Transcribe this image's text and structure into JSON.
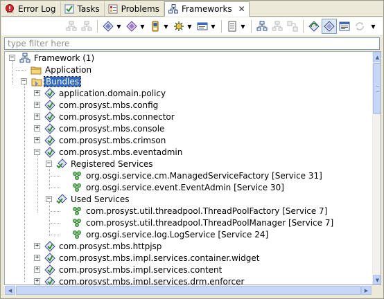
{
  "tabs": [
    {
      "label": "Error Log",
      "icon": "error-log-icon",
      "active": false
    },
    {
      "label": "Tasks",
      "icon": "tasks-icon",
      "active": false
    },
    {
      "label": "Problems",
      "icon": "problems-icon",
      "active": false
    },
    {
      "label": "Frameworks",
      "icon": "frameworks-icon",
      "active": true,
      "close": "✕"
    }
  ],
  "toolbar": {
    "buttons": [
      "connect-framework-icon",
      "disconnect-framework-icon",
      "install-bundle-icon",
      "start-bundle-icon",
      "mobile-device-icon",
      "remote-application-icon",
      "view-menu-icon",
      "properties-icon",
      "show-bundles-icon",
      "show-packages-icon",
      "show-services-icon",
      "refresh-services-icon",
      "show-bundle-ids-icon",
      "console-icon",
      "sync-icon"
    ],
    "dropdown_glyph": "▼"
  },
  "filter": {
    "placeholder": "type filter here",
    "value": ""
  },
  "tree": {
    "framework": "Framework (1)",
    "application": "Application",
    "bundles": "Bundles",
    "bundle_items": [
      "application.domain.policy",
      "com.prosyst.mbs.config",
      "com.prosyst.mbs.connector",
      "com.prosyst.mbs.console",
      "com.prosyst.mbs.crimson",
      "com.prosyst.mbs.eventadmin"
    ],
    "registered_services": "Registered Services",
    "registered_items": [
      "org.osgi.service.cm.ManagedServiceFactory [Service 31]",
      "org.osgi.service.event.EventAdmin [Service 30]"
    ],
    "used_services": "Used Services",
    "used_items": [
      "com.prosyst.util.threadpool.ThreadPoolFactory [Service 7]",
      "com.prosyst.util.threadpool.ThreadPoolManager [Service 7]",
      "org.osgi.service.log.LogService [Service 24]"
    ],
    "more_bundles": [
      "com.prosyst.mbs.httpjsp",
      "com.prosyst.mbs.impl.services.container.widget",
      "com.prosyst.mbs.impl.services.content",
      "com.prosyst.mbs.impl.services.drm.enforcer"
    ],
    "expander_plus": "+",
    "expander_minus": "−"
  },
  "scroll": {
    "up": "▲",
    "down": "▼",
    "left": "◀",
    "right": "▶"
  }
}
